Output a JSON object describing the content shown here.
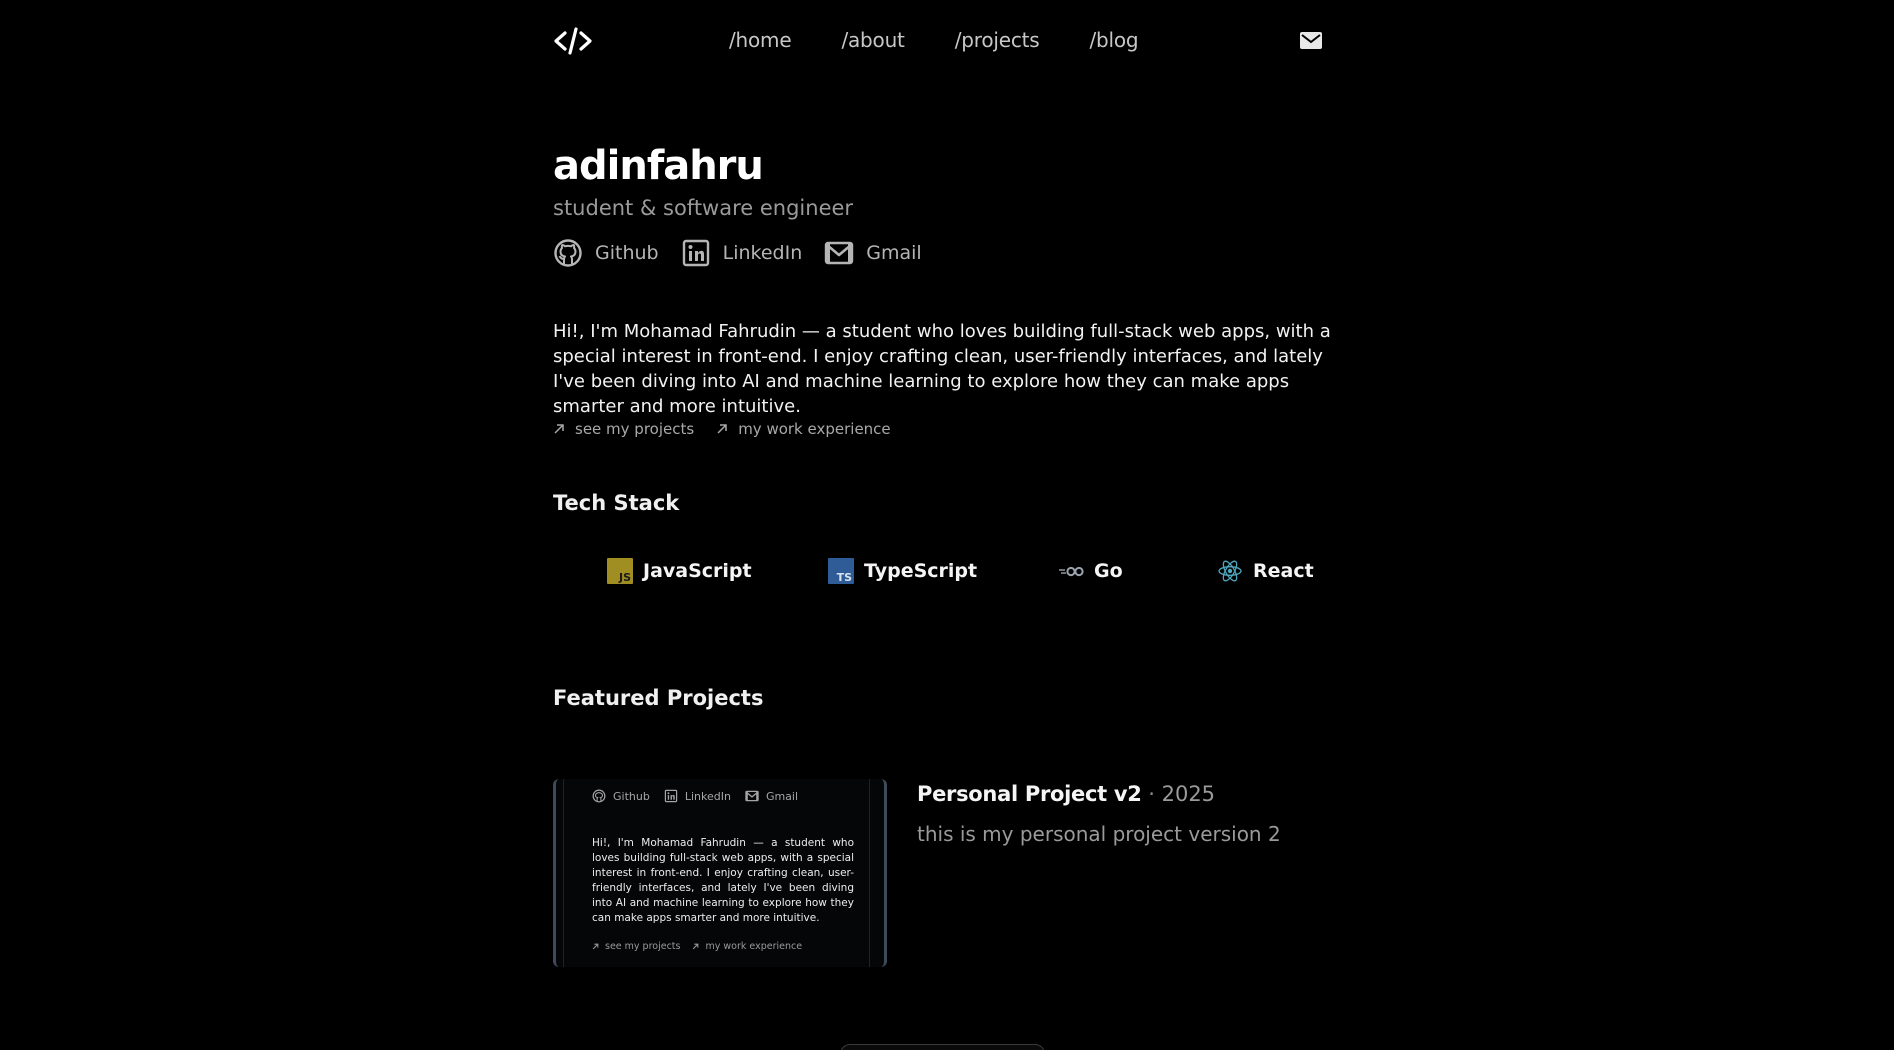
{
  "nav": {
    "logo_icon": "code-brackets-icon",
    "links": [
      {
        "label": "/home"
      },
      {
        "label": "/about"
      },
      {
        "label": "/projects"
      },
      {
        "label": "/blog"
      }
    ],
    "mail_icon": "envelope-icon"
  },
  "hero": {
    "name": "adinfahru",
    "subtitle": "student & software engineer",
    "socials": [
      {
        "label": "Github",
        "icon": "github-icon"
      },
      {
        "label": "LinkedIn",
        "icon": "linkedin-icon"
      },
      {
        "label": "Gmail",
        "icon": "gmail-icon"
      }
    ],
    "bio": "Hi!, I'm Mohamad Fahrudin — a student who loves building full-stack web apps, with a special interest in front-end. I enjoy crafting clean, user-friendly interfaces, and lately I've been diving into AI and machine learning to explore how they can make apps smarter and more intuitive.",
    "quick_links": [
      {
        "label": "see my projects",
        "icon": "arrow-up-right-icon"
      },
      {
        "label": "my work experience",
        "icon": "arrow-up-right-icon"
      }
    ]
  },
  "tech_stack": {
    "title": "Tech Stack",
    "items": [
      {
        "label": "JavaScript",
        "icon": "javascript-icon",
        "color": "#c9b22b"
      },
      {
        "label": "TypeScript",
        "icon": "typescript-icon",
        "color": "#3178c6"
      },
      {
        "label": "Go",
        "icon": "go-icon",
        "color": "#9aa4ad"
      },
      {
        "label": "React",
        "icon": "react-icon",
        "color": "#61dafb"
      }
    ]
  },
  "featured": {
    "title": "Featured Projects",
    "projects": [
      {
        "name": "Personal Project v2",
        "separator": " · ",
        "year": "2025",
        "description": "this is my personal project version 2",
        "thumbnail": {
          "socials": [
            "Github",
            "LinkedIn",
            "Gmail"
          ],
          "bio": "Hi!, I'm Mohamad Fahrudin — a student who loves building full-stack web apps, with a special interest in front-end. I enjoy crafting clean, user-friendly interfaces, and lately I've been diving into AI and machine learning to explore how they can make apps smarter and more intuitive.",
          "links": [
            "see my projects",
            "my work experience"
          ]
        }
      }
    ]
  }
}
